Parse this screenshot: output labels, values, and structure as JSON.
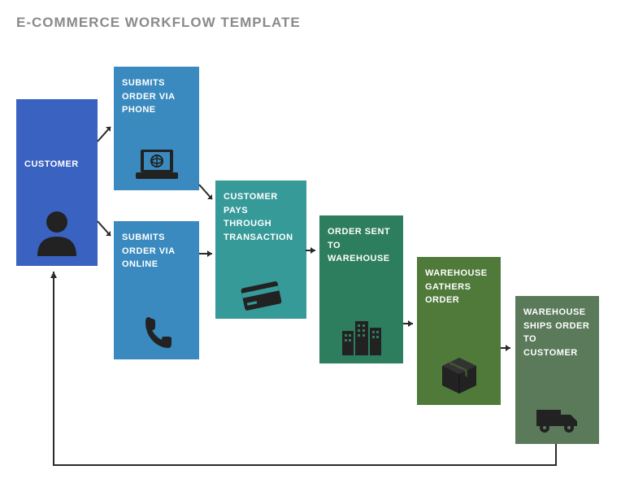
{
  "title": "E-COMMERCE WORKFLOW TEMPLATE",
  "nodes": {
    "customer": {
      "label": "CUSTOMER",
      "color": "#3a62c0"
    },
    "phone": {
      "label": "SUBMITS ORDER VIA PHONE",
      "color": "#3a8abf"
    },
    "online": {
      "label": "SUBMITS ORDER VIA ONLINE",
      "color": "#3a8abf"
    },
    "pay": {
      "label": "CUSTOMER PAYS THROUGH TRANSACTION",
      "color": "#369a99"
    },
    "sent": {
      "label": "ORDER SENT TO WAREHOUSE",
      "color": "#2d7d5f"
    },
    "gather": {
      "label": "WAREHOUSE GATHERS ORDER",
      "color": "#4f7a3a"
    },
    "ship": {
      "label": "WAREHOUSE SHIPS ORDER TO CUSTOMER",
      "color": "#5a7a5a"
    }
  }
}
